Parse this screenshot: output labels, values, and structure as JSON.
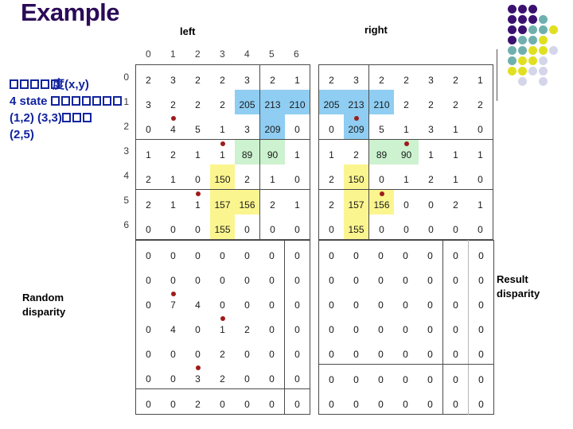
{
  "title": "Example",
  "labels": {
    "left": "left",
    "right": "right",
    "random_disparity": "Random disparity",
    "result_disparity": "Result disparity"
  },
  "description": {
    "line1_prefix_boxes": 5,
    "line1_overlay": "度(x,y)",
    "line2": "4 state",
    "line2_boxes": 7,
    "line3": "(1,2) (3,3)",
    "line3_boxes": 3,
    "line4": "(2,5)"
  },
  "colors": {
    "title": "#2b0a57",
    "description_text": "#12249e",
    "highlight_blue": "#8fcdf2",
    "highlight_green": "#ccf2cf",
    "highlight_yellow": "#fbf58f",
    "marker_red": "#9e1b1b",
    "grid_line": "#4a4a4a",
    "dot_dark_purple": "#3b1170",
    "dot_teal": "#6fb0ae",
    "dot_yellow": "#e0e020",
    "dot_lavender": "#d5d5ea"
  },
  "column_headers": [
    "0",
    "1",
    "2",
    "3",
    "4",
    "5",
    "6"
  ],
  "row_headers": [
    "0",
    "1",
    "2",
    "3",
    "4",
    "5",
    "6"
  ],
  "tables": {
    "left": {
      "rows": [
        [
          "2",
          "3",
          "2",
          "2",
          "3",
          "2",
          "1"
        ],
        [
          "3",
          "2",
          "2",
          "2",
          "205",
          "213",
          "210"
        ],
        [
          "0",
          "4",
          "5",
          "1",
          "3",
          "209",
          "0"
        ],
        [
          "1",
          "2",
          "1",
          "1",
          "89",
          "90",
          "1"
        ],
        [
          "2",
          "1",
          "0",
          "150",
          "2",
          "1",
          "0"
        ],
        [
          "2",
          "1",
          "1",
          "157",
          "156",
          "2",
          "1"
        ],
        [
          "0",
          "0",
          "0",
          "155",
          "0",
          "0",
          "0"
        ]
      ],
      "highlights": [
        [
          null,
          null,
          null,
          null,
          null,
          null,
          null
        ],
        [
          null,
          null,
          null,
          null,
          "blue",
          "blue",
          "blue"
        ],
        [
          null,
          null,
          null,
          null,
          null,
          "blue",
          null
        ],
        [
          null,
          null,
          null,
          null,
          "green",
          "green",
          null
        ],
        [
          null,
          null,
          null,
          "yellow",
          null,
          null,
          null
        ],
        [
          null,
          null,
          null,
          "yellow",
          "yellow",
          null,
          null
        ],
        [
          null,
          null,
          null,
          "yellow",
          null,
          null,
          null
        ]
      ],
      "markers": [
        [
          2,
          1
        ],
        [
          3,
          3
        ],
        [
          5,
          2
        ]
      ]
    },
    "right": {
      "rows": [
        [
          "2",
          "3",
          "2",
          "2",
          "3",
          "2",
          "1"
        ],
        [
          "205",
          "213",
          "210",
          "2",
          "2",
          "2",
          "2"
        ],
        [
          "0",
          "209",
          "5",
          "1",
          "3",
          "1",
          "0"
        ],
        [
          "1",
          "2",
          "89",
          "90",
          "1",
          "1",
          "1"
        ],
        [
          "2",
          "150",
          "0",
          "1",
          "2",
          "1",
          "0"
        ],
        [
          "2",
          "157",
          "156",
          "0",
          "0",
          "2",
          "1"
        ],
        [
          "0",
          "155",
          "0",
          "0",
          "0",
          "0",
          "0"
        ]
      ],
      "highlights": [
        [
          null,
          null,
          null,
          null,
          null,
          null,
          null
        ],
        [
          "blue",
          "blue",
          "blue",
          null,
          null,
          null,
          null
        ],
        [
          null,
          "blue",
          null,
          null,
          null,
          null,
          null
        ],
        [
          null,
          null,
          "green",
          "green",
          null,
          null,
          null
        ],
        [
          null,
          "yellow",
          null,
          null,
          null,
          null,
          null
        ],
        [
          null,
          "yellow",
          "yellow",
          null,
          null,
          null,
          null
        ],
        [
          null,
          "yellow",
          null,
          null,
          null,
          null,
          null
        ]
      ],
      "markers": [
        [
          2,
          1
        ],
        [
          3,
          3
        ],
        [
          5,
          2
        ]
      ]
    },
    "random": {
      "rows": [
        [
          "0",
          "0",
          "0",
          "0",
          "0",
          "0",
          "0"
        ],
        [
          "0",
          "0",
          "0",
          "0",
          "0",
          "0",
          "0"
        ],
        [
          "0",
          "7",
          "4",
          "0",
          "0",
          "0",
          "0"
        ],
        [
          "0",
          "4",
          "0",
          "1",
          "2",
          "0",
          "0"
        ],
        [
          "0",
          "0",
          "0",
          "2",
          "0",
          "0",
          "0"
        ],
        [
          "0",
          "0",
          "3",
          "2",
          "0",
          "0",
          "0"
        ],
        [
          "0",
          "0",
          "2",
          "0",
          "0",
          "0",
          "0"
        ]
      ],
      "markers": [
        [
          2,
          1
        ],
        [
          3,
          3
        ],
        [
          5,
          2
        ]
      ]
    },
    "result": {
      "rows": [
        [
          "0",
          "0",
          "0",
          "0",
          "0",
          "0",
          "0"
        ],
        [
          "0",
          "0",
          "0",
          "0",
          "0",
          "0",
          "0"
        ],
        [
          "0",
          "0",
          "0",
          "0",
          "0",
          "0",
          "0"
        ],
        [
          "0",
          "0",
          "0",
          "0",
          "0",
          "0",
          "0"
        ],
        [
          "0",
          "0",
          "0",
          "0",
          "0",
          "0",
          "0"
        ],
        [
          "0",
          "0",
          "0",
          "0",
          "0",
          "0",
          "0"
        ],
        [
          "0",
          "0",
          "0",
          "0",
          "0",
          "0",
          "0"
        ]
      ],
      "markers": []
    }
  },
  "dot_grid": {
    "rows": [
      [
        "dark",
        "dark",
        "dark",
        null,
        null
      ],
      [
        "dark",
        "dark",
        "dark",
        "teal",
        null
      ],
      [
        "dark",
        "dark",
        "teal",
        "teal",
        "yellow"
      ],
      [
        "dark",
        "teal",
        "teal",
        "yellow",
        null
      ],
      [
        "teal",
        "teal",
        "yellow",
        "yellow",
        "lav"
      ],
      [
        "teal",
        "yellow",
        "yellow",
        "lav",
        null
      ],
      [
        "yellow",
        "yellow",
        "lav",
        "lav",
        null
      ],
      [
        null,
        "lav",
        null,
        "lav",
        null
      ]
    ]
  }
}
